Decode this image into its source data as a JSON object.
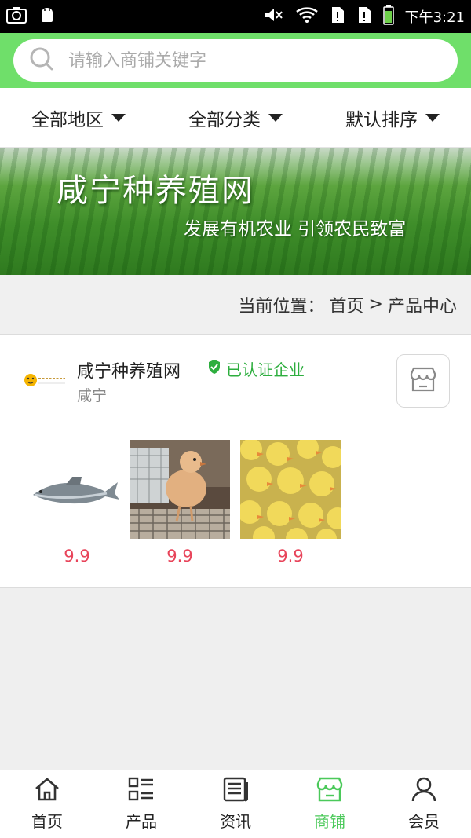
{
  "status_bar": {
    "time": "下午3:21"
  },
  "search": {
    "placeholder": "请输入商铺关键字"
  },
  "filters": [
    {
      "label": "全部地区"
    },
    {
      "label": "全部分类"
    },
    {
      "label": "默认排序"
    }
  ],
  "banner": {
    "title": "咸宁种养殖网",
    "slogan": "发展有机农业 引领农民致富"
  },
  "breadcrumb": {
    "prefix": "当前位置：",
    "home": "首页",
    "separator": ">",
    "current": "产品中心"
  },
  "store": {
    "name": "咸宁种养殖网",
    "verified_label": "已认证企业",
    "city": "咸宁",
    "products": [
      {
        "price": "9.9",
        "image": "fish-image"
      },
      {
        "price": "9.9",
        "image": "chick-image"
      },
      {
        "price": "9.9",
        "image": "ducklings-image"
      }
    ]
  },
  "bottom_nav": [
    {
      "label": "首页",
      "icon": "home-icon",
      "active": false
    },
    {
      "label": "产品",
      "icon": "products-icon",
      "active": false
    },
    {
      "label": "资讯",
      "icon": "news-icon",
      "active": false
    },
    {
      "label": "商铺",
      "icon": "store-icon",
      "active": true
    },
    {
      "label": "会员",
      "icon": "user-icon",
      "active": false
    }
  ],
  "colors": {
    "header_green": "#6fdf6a",
    "active_green": "#4bc95a",
    "price_red": "#e8445a",
    "verified_green": "#2dae3e"
  }
}
